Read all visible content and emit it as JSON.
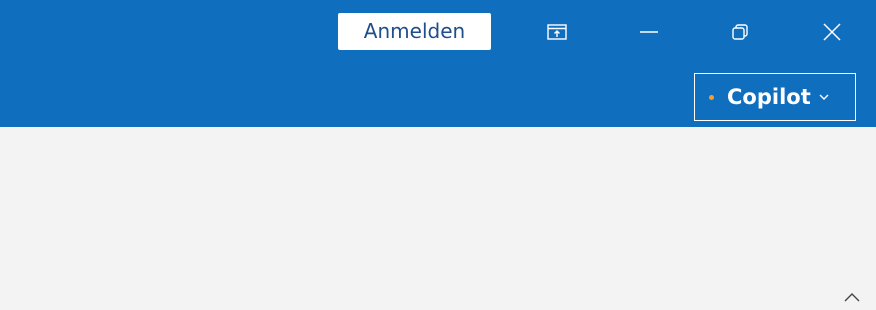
{
  "titlebar": {
    "signin_label": "Anmelden",
    "icons": {
      "ribbon_display": "ribbon-display-options-icon",
      "minimize": "minimize-icon",
      "restore": "restore-icon",
      "close": "close-icon"
    }
  },
  "ribbon": {
    "copilot_label": "Copilot",
    "collapse_icon": "chevron-up-icon"
  },
  "colors": {
    "titlebar_bg": "#106ebe",
    "content_bg": "#f3f3f3",
    "copilot_dot": "#f0a030"
  }
}
